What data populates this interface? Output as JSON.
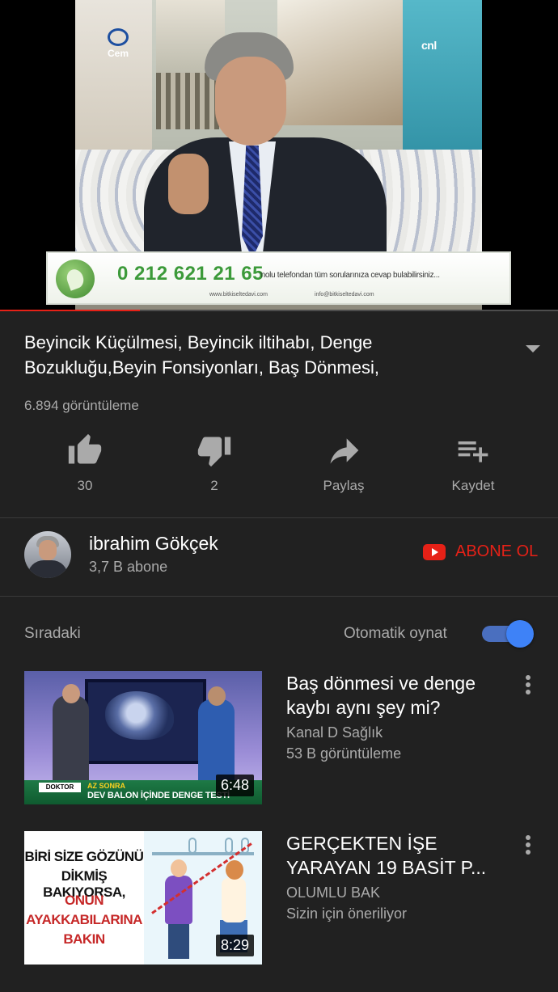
{
  "player": {
    "channel_logo": "cnl",
    "cem_logo": "Cem",
    "banner_phone": "0 212 621 21 65",
    "banner_text": "'nolu telefondan tüm sorularınıza cevap bulabilirsiniz...",
    "banner_web": "www.bitkiseltedavi.com",
    "banner_email": "info@bitkiseltedavi.com",
    "progress_fraction": 0.25
  },
  "video": {
    "title": "Beyincik Küçülmesi, Beyincik iltihabı, Denge Bozukluğu,Beyin Fonsiyonları, Baş Dönmesi,",
    "views": "6.894 görüntüleme"
  },
  "actions": {
    "like_count": "30",
    "dislike_count": "2",
    "share_label": "Paylaş",
    "save_label": "Kaydet"
  },
  "channel": {
    "name": "ibrahim Gökçek",
    "subscribers": "3,7 B abone",
    "subscribe_label": "ABONE OL"
  },
  "upnext": {
    "label": "Sıradaki",
    "autoplay_label": "Otomatik oynat",
    "autoplay_on": true
  },
  "videos": [
    {
      "title_line1": "Baş dönmesi ve denge",
      "title_line2": "kaybı aynı şey mi?",
      "channel": "Kanal D Sağlık",
      "meta": "53 B görüntüleme",
      "duration": "6:48",
      "thumb_logo": "DOKTOR",
      "thumb_az": "AZ SONRA",
      "thumb_caption": "DEV BALON İÇİNDE DENGE TESTİ"
    },
    {
      "title_line1": "GERÇEKTEN İŞE",
      "title_line2": "YARAYAN 19 BASİT P...",
      "channel": "OLUMLU BAK",
      "meta": "Sizin için öneriliyor",
      "duration": "8:29",
      "thumb_line1": "BİRİ SİZE GÖZÜNÜ",
      "thumb_line2": "DİKMİŞ BAKIYORSA,",
      "thumb_line3": "ONUN",
      "thumb_line4": "AYAKKABILARINA",
      "thumb_line5": "BAKIN"
    }
  ],
  "colors": {
    "background": "#212121",
    "accent_red": "#e62117",
    "toggle_blue": "#3e82f7",
    "secondary_text": "#aaaaaa"
  }
}
